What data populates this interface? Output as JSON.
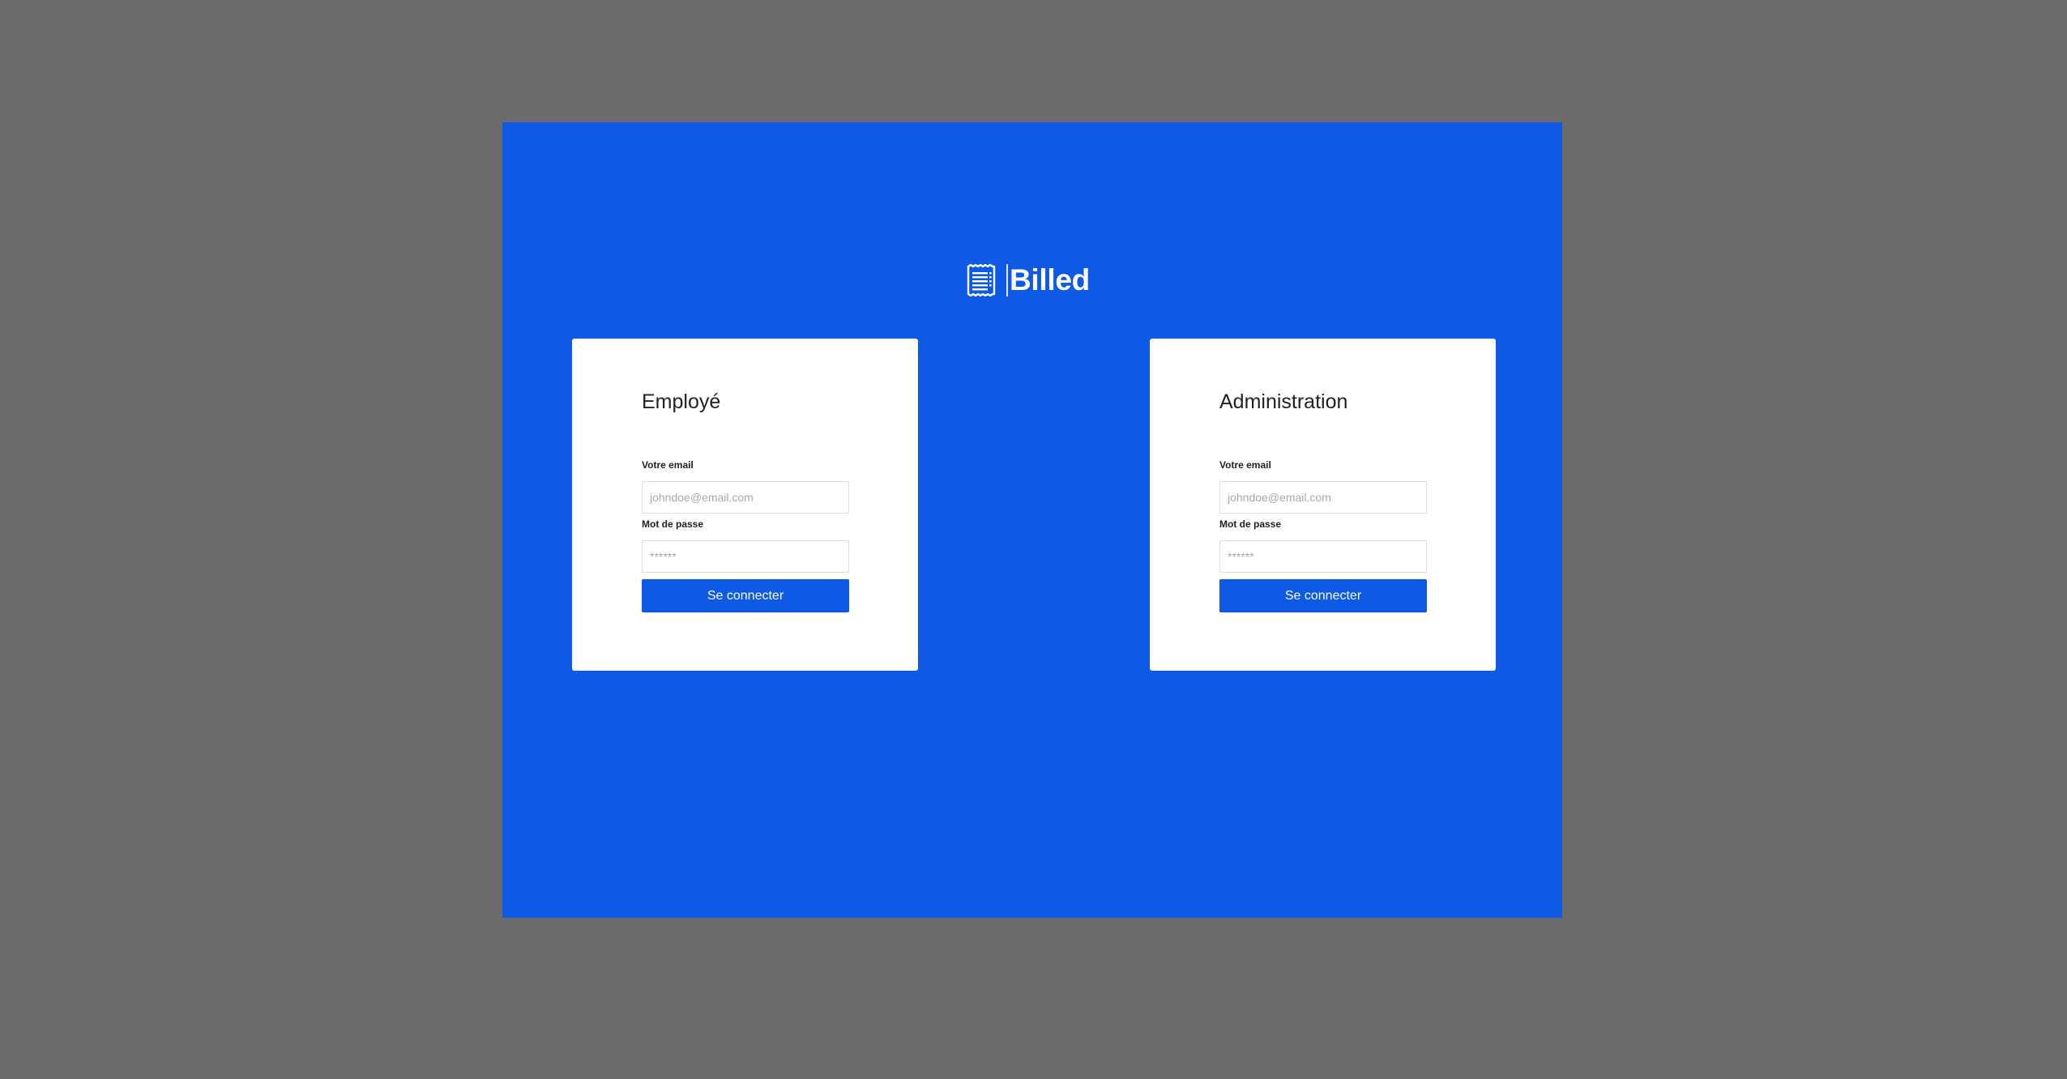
{
  "brand": {
    "name": "Billed",
    "icon": "receipt-icon"
  },
  "colors": {
    "background": "#6b6b6b",
    "primary": "#0e5ae5",
    "card": "#ffffff"
  },
  "employee": {
    "title": "Employé",
    "email_label": "Votre email",
    "email_placeholder": "johndoe@email.com",
    "password_label": "Mot de passe",
    "password_placeholder": "******",
    "submit_label": "Se connecter"
  },
  "admin": {
    "title": "Administration",
    "email_label": "Votre email",
    "email_placeholder": "johndoe@email.com",
    "password_label": "Mot de passe",
    "password_placeholder": "******",
    "submit_label": "Se connecter"
  }
}
